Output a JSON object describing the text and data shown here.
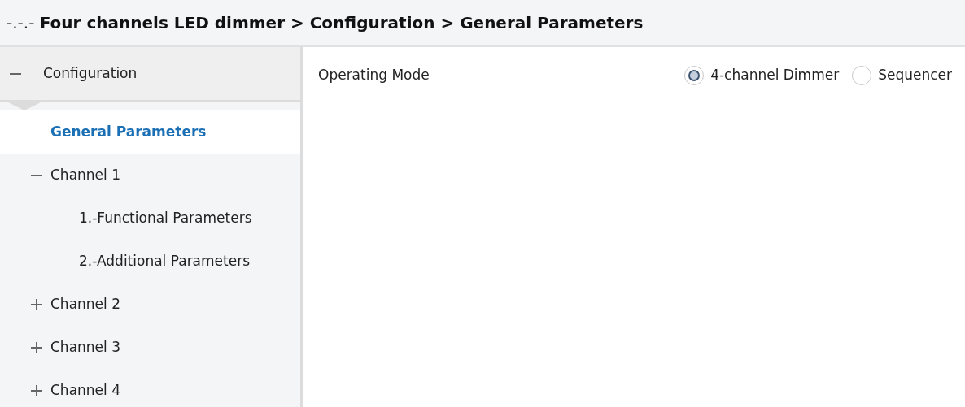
{
  "breadcrumb": "-.-.- **Four channels LED dimmer > Configuration > General Parameters**",
  "tree": [
    {
      "label": "Configuration",
      "expanded": true,
      "children": [
        {
          "label": "General Parameters",
          "selected": true
        },
        {
          "label": "Channel 1",
          "expanded": true,
          "children": [
            {
              "label": "1.-Functional Parameters",
              "selected": false
            },
            {
              "label": "2.-Additional Parameters",
              "selected": false
            }
          ]
        },
        {
          "label": "Channel 2",
          "expanded": false
        },
        {
          "label": "Channel 3",
          "expanded": false
        },
        {
          "label": "Channel 4",
          "expanded": false
        }
      ]
    }
  ],
  "parameters": [
    {
      "label": "Operating Mode",
      "options": [
        {
          "label": "4-channel Dimmer",
          "selected": true
        },
        {
          "label": "Sequencer",
          "selected": false
        }
      ]
    }
  ]
}
